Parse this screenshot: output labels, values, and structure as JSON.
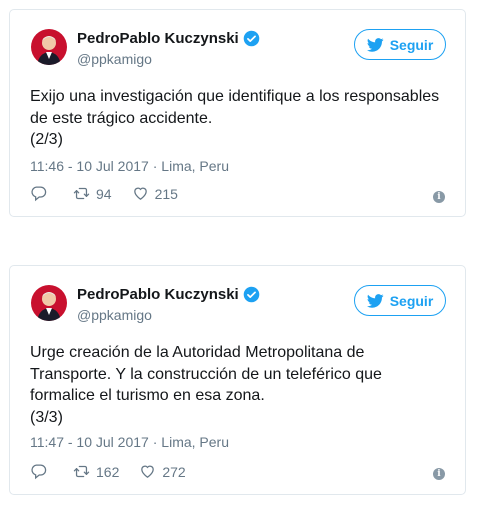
{
  "tweets": [
    {
      "author_name": "PedroPablo Kuczynski",
      "handle": "@ppkamigo",
      "follow_label": "Seguir",
      "text_lines": [
        "Exijo una investigación que identifique a los responsables",
        "de este trágico accidente.",
        "(2/3)"
      ],
      "timestamp": "11:46 - 10 Jul 2017",
      "location": "Lima, Peru",
      "retweets": "94",
      "likes": "215"
    },
    {
      "author_name": "PedroPablo Kuczynski",
      "handle": "@ppkamigo",
      "follow_label": "Seguir",
      "text_lines": [
        "Urge creación de la Autoridad Metropolitana de",
        "Transporte. Y la construcción de un teleférico que",
        "formalice el turismo en esa zona.",
        "(3/3)"
      ],
      "timestamp": "11:47 - 10 Jul 2017",
      "location": "Lima, Peru",
      "retweets": "162",
      "likes": "272"
    }
  ],
  "colors": {
    "accent": "#1da1f2",
    "muted": "#657786",
    "border": "#e1e8ed",
    "avatar_red": "#c8102e"
  },
  "icons": [
    "verified-icon",
    "twitter-bird-icon",
    "reply-icon",
    "retweet-icon",
    "like-icon",
    "info-icon"
  ],
  "separator": " · "
}
